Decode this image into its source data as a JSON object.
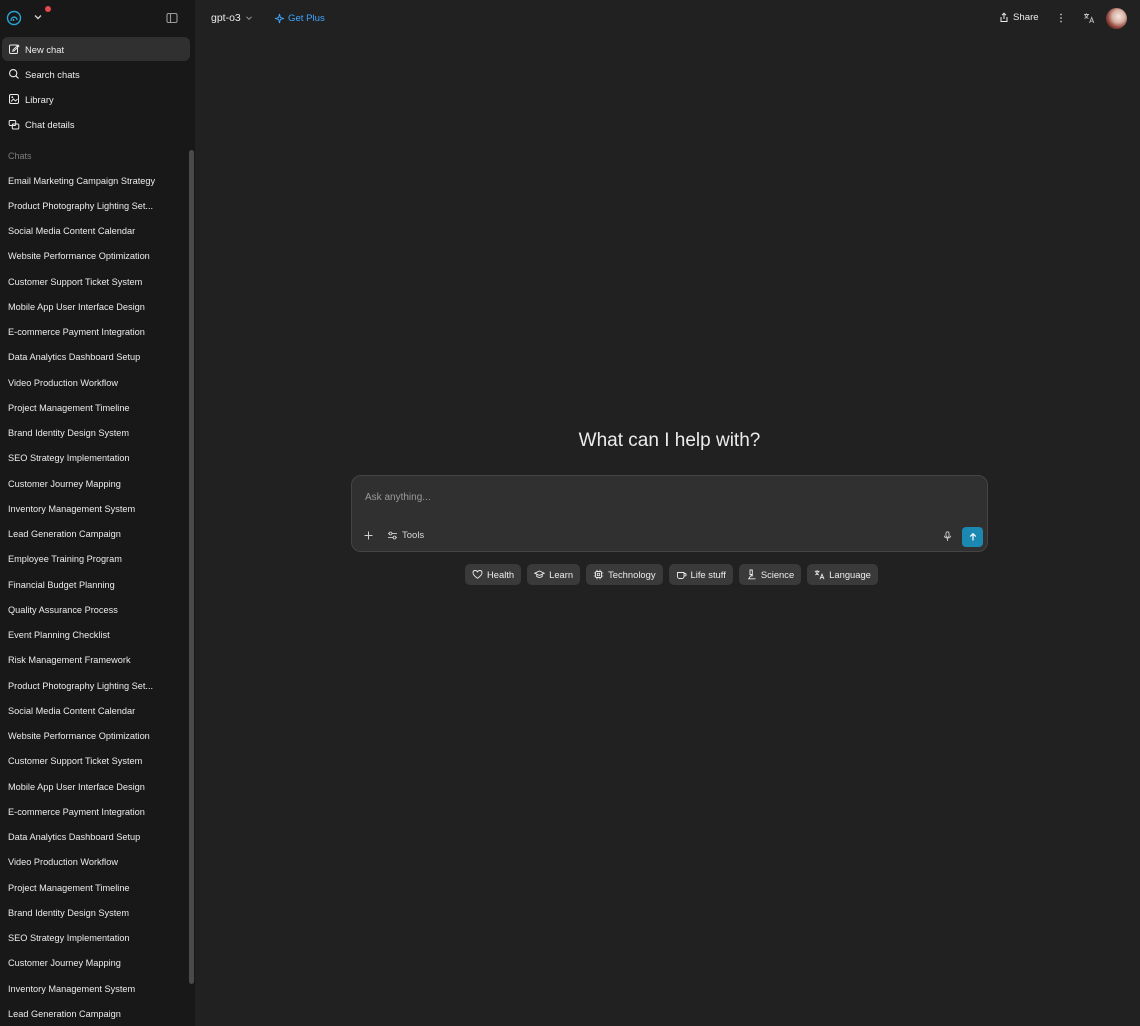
{
  "sidebar": {
    "nav": [
      {
        "label": "New chat",
        "icon": "edit-icon"
      },
      {
        "label": "Search chats",
        "icon": "search-icon"
      },
      {
        "label": "Library",
        "icon": "library-icon"
      },
      {
        "label": "Chat details",
        "icon": "chat-details-icon"
      }
    ],
    "section_label": "Chats",
    "chats": [
      "Email Marketing Campaign Strategy",
      "Product Photography Lighting Set...",
      "Social Media Content Calendar",
      "Website Performance Optimization",
      "Customer Support Ticket System",
      "Mobile App User Interface Design",
      "E-commerce Payment Integration",
      "Data Analytics Dashboard Setup",
      "Video Production Workflow",
      "Project Management Timeline",
      "Brand Identity Design System",
      "SEO Strategy Implementation",
      "Customer Journey Mapping",
      "Inventory Management System",
      "Lead Generation Campaign",
      "Employee Training Program",
      "Financial Budget Planning",
      "Quality Assurance Process",
      "Event Planning Checklist",
      "Risk Management Framework",
      "Product Photography Lighting Set...",
      "Social Media Content Calendar",
      "Website Performance Optimization",
      "Customer Support Ticket System",
      "Mobile App User Interface Design",
      "E-commerce Payment Integration",
      "Data Analytics Dashboard Setup",
      "Video Production Workflow",
      "Project Management Timeline",
      "Brand Identity Design System",
      "SEO Strategy Implementation",
      "Customer Journey Mapping",
      "Inventory Management System",
      "Lead Generation Campaign"
    ]
  },
  "header": {
    "model": "gpt-o3",
    "get_plus": "Get Plus",
    "share": "Share"
  },
  "main": {
    "hero": "What can I help with?",
    "composer_placeholder": "Ask anything...",
    "tools_label": "Tools",
    "chips": [
      {
        "label": "Health",
        "icon": "heart-icon"
      },
      {
        "label": "Learn",
        "icon": "graduation-cap-icon"
      },
      {
        "label": "Technology",
        "icon": "chip-icon"
      },
      {
        "label": "Life stuff",
        "icon": "coffee-cup-icon"
      },
      {
        "label": "Science",
        "icon": "microscope-icon"
      },
      {
        "label": "Language",
        "icon": "translate-icon"
      }
    ]
  },
  "colors": {
    "background": "#212121",
    "sidebar": "#181818",
    "accent": "#3ea6ff",
    "send_button": "#1a88b1",
    "notification_dot": "#e5484d"
  }
}
